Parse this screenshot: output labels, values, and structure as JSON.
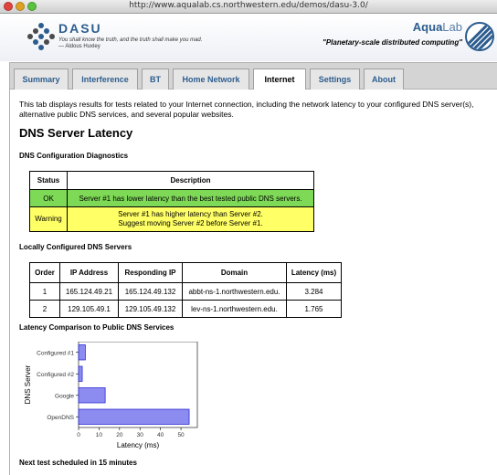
{
  "window": {
    "url": "http://www.aqualab.cs.northwestern.edu/demos/dasu-3.0/"
  },
  "header": {
    "logo_name": "DASU",
    "quote": "You shall know the truth, and the truth shall make you mad.",
    "author": "— Aldous Huxley",
    "brand_bold": "Aqua",
    "brand_light": "Lab",
    "tagline": "\"Planetary-scale distributed computing\""
  },
  "tabs": [
    {
      "label": "Summary",
      "active": false
    },
    {
      "label": "Interference",
      "active": false
    },
    {
      "label": "BT",
      "active": false
    },
    {
      "label": "Home Network",
      "active": false
    },
    {
      "label": "Internet",
      "active": true
    },
    {
      "label": "Settings",
      "active": false
    },
    {
      "label": "About",
      "active": false
    }
  ],
  "main": {
    "intro": "This tab displays results for tests related to your Internet connection, including the network latency to your configured DNS server(s), alternative public DNS services, and several popular websites.",
    "title": "DNS Server Latency",
    "diagnostics_heading": "DNS Configuration Diagnostics",
    "diagnostics": {
      "headers": [
        "Status",
        "Description"
      ],
      "rows": [
        {
          "status": "OK",
          "line1": "Server #1 has lower latency than the best tested public DNS servers.",
          "line2": ""
        },
        {
          "status": "Warning",
          "line1": "Server #1 has higher latency than Server #2.",
          "line2": "Suggest moving Server #2 before Server #1."
        }
      ]
    },
    "local_heading": "Locally Configured DNS Servers",
    "dns_table": {
      "headers": [
        "Order",
        "IP Address",
        "Responding IP",
        "Domain",
        "Latency (ms)"
      ],
      "rows": [
        [
          "1",
          "165.124.49.21",
          "165.124.49.132",
          "abbt-ns-1.northwestern.edu.",
          "3.284"
        ],
        [
          "2",
          "129.105.49.1",
          "129.105.49.132",
          "lev-ns-1.northwestern.edu.",
          "1.765"
        ]
      ]
    },
    "comparison_heading": "Latency Comparison to Public DNS Services",
    "footer_note": "Next test scheduled in 15 minutes"
  },
  "colors": {
    "ok": "#7ed957",
    "warning": "#ffff66",
    "bar_fill": "#8c8cf0",
    "bar_stroke": "#2b2bd4",
    "accent": "#2c5d8e"
  },
  "chart_data": {
    "type": "bar",
    "orientation": "horizontal",
    "categories": [
      "Configured #1",
      "Configured #2",
      "Google",
      "OpenDNS"
    ],
    "values": [
      3.3,
      1.8,
      13,
      54
    ],
    "xlabel": "Latency (ms)",
    "ylabel": "DNS Server",
    "xlim": [
      0,
      58
    ],
    "xticks": [
      0,
      10,
      20,
      30,
      40,
      50
    ],
    "grid": false
  }
}
